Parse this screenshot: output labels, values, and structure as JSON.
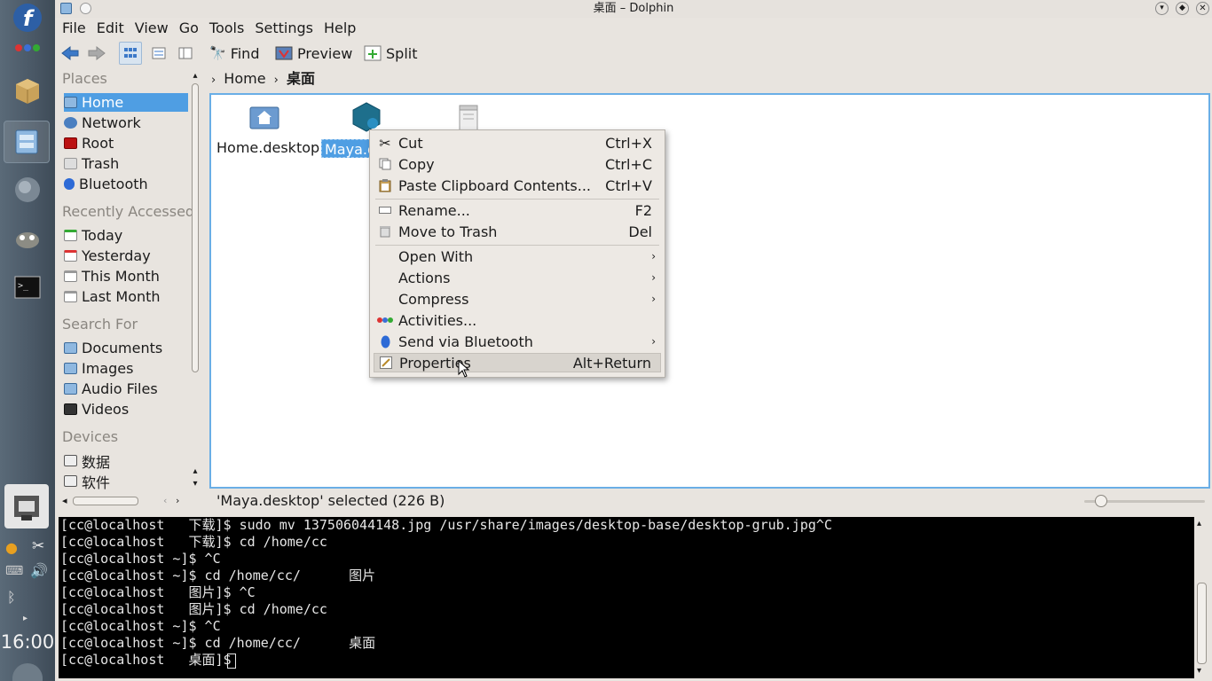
{
  "window": {
    "title": "桌面 – Dolphin"
  },
  "menubar": [
    "File",
    "Edit",
    "View",
    "Go",
    "Tools",
    "Settings",
    "Help"
  ],
  "toolbar": {
    "find": "Find",
    "preview": "Preview",
    "split": "Split"
  },
  "breadcrumb": {
    "home": "Home",
    "current": "桌面"
  },
  "places": {
    "sections": {
      "places": "Places",
      "recent": "Recently Accessed",
      "search": "Search For",
      "devices": "Devices"
    },
    "items": [
      "Home",
      "Network",
      "Root",
      "Trash",
      "Bluetooth"
    ],
    "recent": [
      "Today",
      "Yesterday",
      "This Month",
      "Last Month"
    ],
    "search": [
      "Documents",
      "Images",
      "Audio Files",
      "Videos"
    ],
    "devices": [
      "数据",
      "软件"
    ]
  },
  "files": [
    {
      "name": "Home.desktop"
    },
    {
      "name": "Maya.d"
    }
  ],
  "context_menu": [
    {
      "label": "Cut",
      "shortcut": "Ctrl+X"
    },
    {
      "label": "Copy",
      "shortcut": "Ctrl+C"
    },
    {
      "label": "Paste Clipboard Contents...",
      "shortcut": "Ctrl+V"
    },
    {
      "label": "Rename...",
      "shortcut": "F2"
    },
    {
      "label": "Move to Trash",
      "shortcut": "Del"
    },
    {
      "label": "Open With"
    },
    {
      "label": "Actions"
    },
    {
      "label": "Compress"
    },
    {
      "label": "Activities..."
    },
    {
      "label": "Send via Bluetooth"
    },
    {
      "label": "Properties",
      "shortcut": "Alt+Return"
    }
  ],
  "status": {
    "text": "'Maya.desktop'  selected (226 B)"
  },
  "terminal": [
    "[cc@localhost   下载]$ sudo mv 137506044148.jpg /usr/share/images/desktop-base/desktop-grub.jpg^C",
    "[cc@localhost   下载]$ cd /home/cc",
    "[cc@localhost ~]$ ^C",
    "[cc@localhost ~]$ cd /home/cc/      图片",
    "[cc@localhost   图片]$ ^C",
    "[cc@localhost   图片]$ cd /home/cc",
    "[cc@localhost ~]$ ^C",
    "[cc@localhost ~]$ cd /home/cc/      桌面",
    "[cc@localhost   桌面]$ "
  ],
  "clock": "16:00",
  "colors": {
    "selection": "#4f9ee3",
    "focus_border": "#6aaee6",
    "panel": "#4a5866"
  }
}
